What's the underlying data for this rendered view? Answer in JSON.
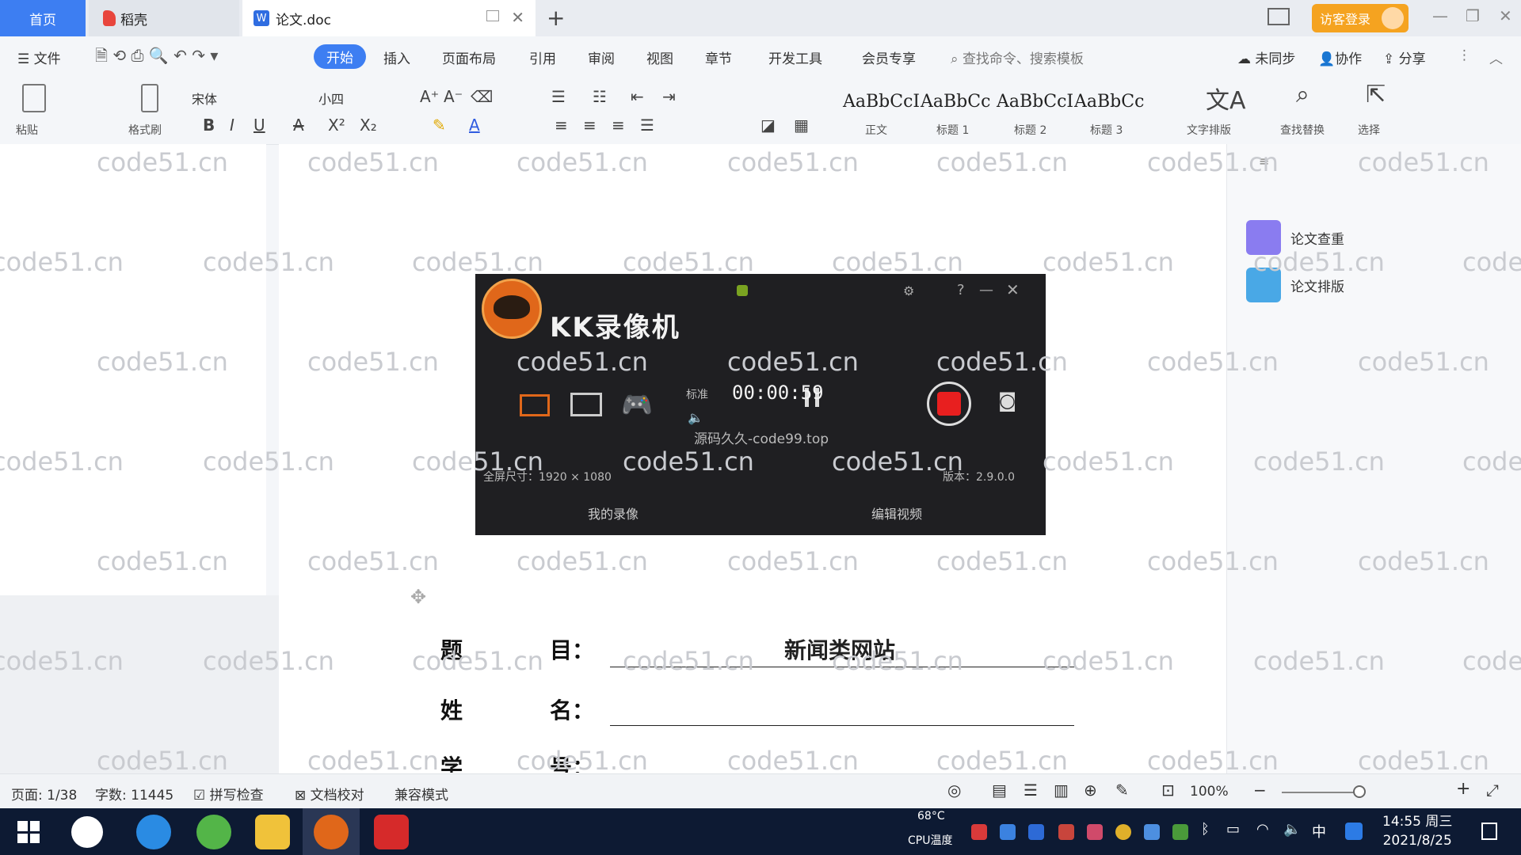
{
  "tabs": [
    {
      "label": "首页"
    },
    {
      "label": "稻壳"
    },
    {
      "label": "论文.doc"
    }
  ],
  "header": {
    "visitor_login": "访客登录"
  },
  "menu": {
    "file": "文件",
    "items": [
      "开始",
      "插入",
      "页面布局",
      "引用",
      "审阅",
      "视图",
      "章节",
      "开发工具",
      "会员专享"
    ],
    "search_cmd": "查找命令、搜索模板",
    "sync": "未同步",
    "collab": "协作",
    "share": "分享"
  },
  "ribbon": {
    "paste": "粘贴",
    "format_painter": "格式刷",
    "font": "宋体",
    "font_size": "小四",
    "styles": [
      {
        "preview": "AaBbCcI",
        "label": "正文"
      },
      {
        "preview": "AaBbCc",
        "label": "标题 1"
      },
      {
        "preview": "AaBbCcI",
        "label": "标题 2"
      },
      {
        "preview": "AaBbCc",
        "label": "标题 3"
      }
    ],
    "text_tools": "文字排版",
    "find_replace": "查找替换",
    "select": "选择"
  },
  "right_panel": {
    "items": [
      {
        "label": "论文查重"
      },
      {
        "label": "论文排版"
      }
    ]
  },
  "recorder": {
    "title": "KK录像机",
    "tab_label": "标准",
    "timer": "00:00:59",
    "watermark_text": "源码久久-code99.top",
    "screen_size": "全屏尺寸：1920 × 1080",
    "version": "版本：2.9.0.0",
    "btn_left": "我的录像",
    "btn_right": "编辑视频"
  },
  "document": {
    "form": [
      {
        "label_a": "题",
        "label_b": "目：",
        "value": "新闻类网站"
      },
      {
        "label_a": "姓",
        "label_b": "名：",
        "value": ""
      },
      {
        "label_a": "学",
        "label_b": "号：",
        "value": ""
      }
    ]
  },
  "watermark": "code51.cn",
  "status": {
    "page": "页面: 1/38",
    "words": "字数: 11445",
    "spell": "拼写检查",
    "doc_check": "文档校对",
    "compat": "兼容模式",
    "zoom": "100%"
  },
  "taskbar": {
    "cpu_temp": "68°C",
    "cpu_label": "CPU温度",
    "ime": "中",
    "time": "14:55 周三",
    "date": "2021/8/25"
  },
  "colors": {
    "accent": "#3d7ef2",
    "visitor": "#f5a320",
    "record_red": "#e81f1f",
    "taskbar": "#0d1a33"
  }
}
